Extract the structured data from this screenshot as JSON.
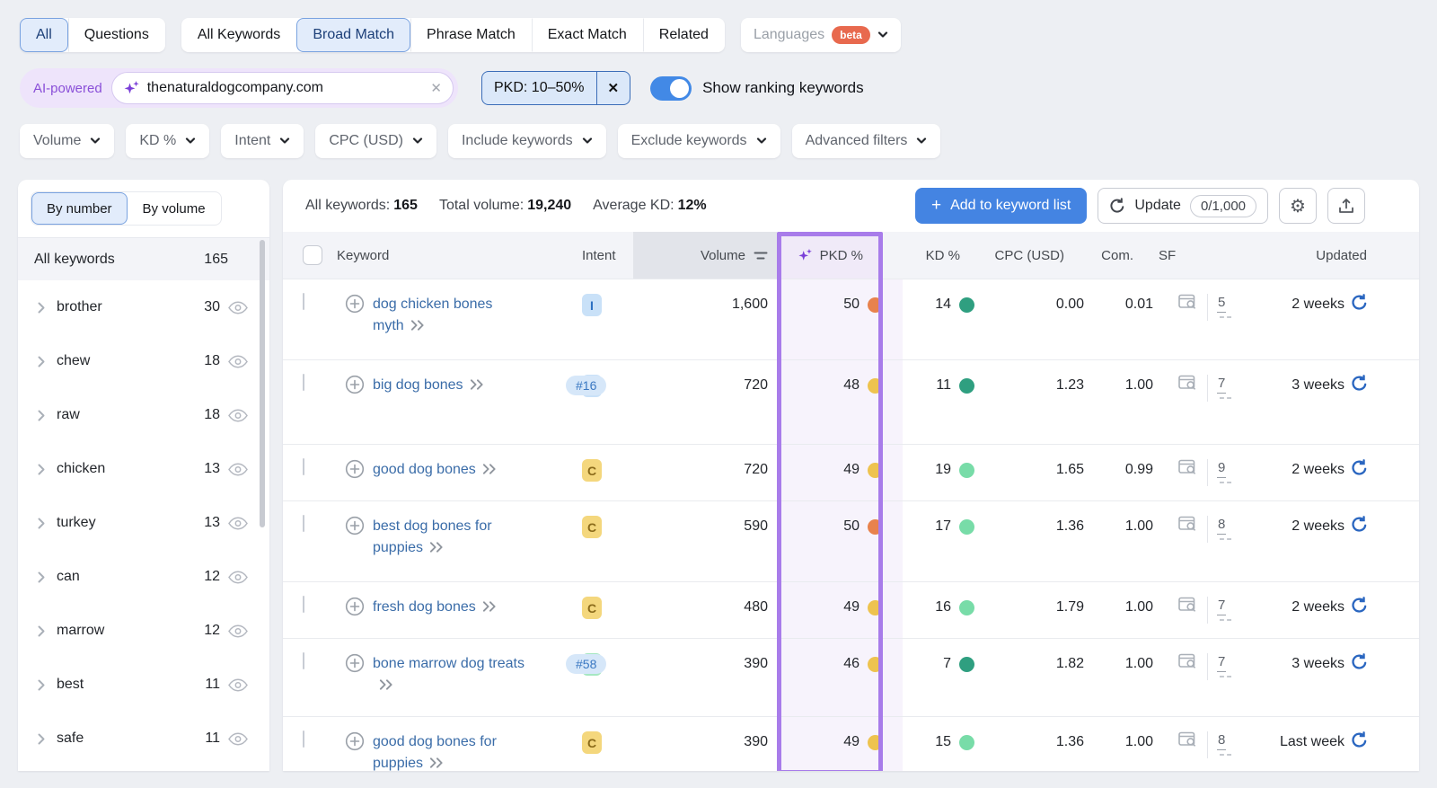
{
  "filters": {
    "scope_tabs": [
      {
        "label": "All",
        "selected": true
      },
      {
        "label": "Questions",
        "selected": false
      }
    ],
    "match_tabs": [
      {
        "label": "All Keywords",
        "selected": false
      },
      {
        "label": "Broad Match",
        "selected": true
      },
      {
        "label": "Phrase Match",
        "selected": false
      },
      {
        "label": "Exact Match",
        "selected": false
      },
      {
        "label": "Related",
        "selected": false
      }
    ],
    "languages": {
      "label": "Languages",
      "badge": "beta"
    },
    "ai_label": "AI-powered",
    "domain": "thenaturaldogcompany.com",
    "pkd_filter": "PKD: 10–50%",
    "toggle_label": "Show ranking keywords",
    "dropdowns": [
      "Volume",
      "KD %",
      "Intent",
      "CPC (USD)",
      "Include keywords",
      "Exclude keywords",
      "Advanced filters"
    ]
  },
  "sidebar": {
    "tabs": [
      {
        "label": "By number",
        "selected": true
      },
      {
        "label": "By volume",
        "selected": false
      }
    ],
    "all_label": "All keywords",
    "all_count": "165",
    "groups": [
      {
        "name": "brother",
        "count": "30"
      },
      {
        "name": "chew",
        "count": "18"
      },
      {
        "name": "raw",
        "count": "18"
      },
      {
        "name": "chicken",
        "count": "13"
      },
      {
        "name": "turkey",
        "count": "13"
      },
      {
        "name": "can",
        "count": "12"
      },
      {
        "name": "marrow",
        "count": "12"
      },
      {
        "name": "best",
        "count": "11"
      },
      {
        "name": "safe",
        "count": "11"
      }
    ]
  },
  "toolbar": {
    "stats": [
      {
        "label": "All keywords:",
        "value": "165"
      },
      {
        "label": "Total volume:",
        "value": "19,240"
      },
      {
        "label": "Average KD:",
        "value": "12%"
      }
    ],
    "add_button_label": "Add to keyword list",
    "update_label": "Update",
    "update_quota": "0/1,000"
  },
  "table": {
    "columns": {
      "keyword": "Keyword",
      "intent": "Intent",
      "volume": "Volume",
      "pkd": "PKD %",
      "kd": "KD %",
      "cpc": "CPC (USD)",
      "com": "Com.",
      "sf": "SF",
      "updated": "Updated"
    },
    "rows": [
      {
        "keyword": "dog chicken bones myth",
        "rank": "",
        "intent": "I",
        "volume": "1,600",
        "pkd": "50",
        "pkd_dot": "orange",
        "kd": "14",
        "kd_dot": "teal",
        "cpc": "0.00",
        "com": "0.01",
        "sf": "5",
        "updated": "2 weeks"
      },
      {
        "keyword": "big dog bones",
        "rank": "#16",
        "intent": "I",
        "volume": "720",
        "pkd": "48",
        "pkd_dot": "yellow",
        "kd": "11",
        "kd_dot": "teal",
        "cpc": "1.23",
        "com": "1.00",
        "sf": "7",
        "updated": "3 weeks"
      },
      {
        "keyword": "good dog bones",
        "rank": "",
        "intent": "C",
        "volume": "720",
        "pkd": "49",
        "pkd_dot": "yellow",
        "kd": "19",
        "kd_dot": "green",
        "cpc": "1.65",
        "com": "0.99",
        "sf": "9",
        "updated": "2 weeks"
      },
      {
        "keyword": "best dog bones for puppies",
        "rank": "",
        "intent": "C",
        "volume": "590",
        "pkd": "50",
        "pkd_dot": "orange",
        "kd": "17",
        "kd_dot": "green",
        "cpc": "1.36",
        "com": "1.00",
        "sf": "8",
        "updated": "2 weeks"
      },
      {
        "keyword": "fresh dog bones",
        "rank": "",
        "intent": "C",
        "volume": "480",
        "pkd": "49",
        "pkd_dot": "yellow",
        "kd": "16",
        "kd_dot": "green",
        "cpc": "1.79",
        "com": "1.00",
        "sf": "7",
        "updated": "2 weeks"
      },
      {
        "keyword": "bone marrow dog treats",
        "rank": "#58",
        "intent": "T",
        "volume": "390",
        "pkd": "46",
        "pkd_dot": "yellow",
        "kd": "7",
        "kd_dot": "teal",
        "cpc": "1.82",
        "com": "1.00",
        "sf": "7",
        "updated": "3 weeks"
      },
      {
        "keyword": "good dog bones for puppies",
        "rank": "",
        "intent": "C",
        "volume": "390",
        "pkd": "49",
        "pkd_dot": "yellow",
        "kd": "15",
        "kd_dot": "green",
        "cpc": "1.36",
        "com": "1.00",
        "sf": "8",
        "updated": "Last week"
      }
    ]
  },
  "colors": {
    "accent_blue": "#4484e2",
    "purple_frame": "#a87cea",
    "purple_accent": "#7a3fd8",
    "lavender": "#f7f3fc",
    "dot_orange": "#e8824d",
    "dot_yellow": "#eec34f",
    "dot_teal": "#2f9f80",
    "dot_green": "#78dca8",
    "intent_i_bg": "#c9e1f8",
    "intent_i_fg": "#2a6fc2",
    "intent_c_bg": "#f4d77d",
    "intent_c_fg": "#8a6a1a",
    "intent_t_bg": "#a5e7c1",
    "intent_t_fg": "#257a4e",
    "link_blue": "#3a6ca8",
    "beta_orange": "#e8694e",
    "toggle_blue": "#4289e6",
    "refresh_blue": "#2a66c0",
    "selected_tab_bg": "#e2ecfb",
    "selected_tab_border": "#7aa3e0"
  }
}
